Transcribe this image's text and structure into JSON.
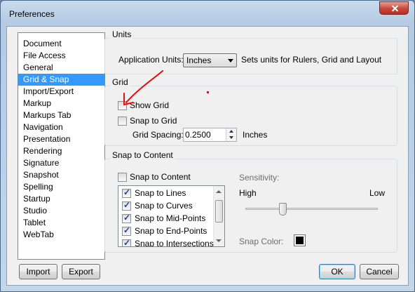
{
  "window": {
    "title": "Preferences"
  },
  "categories": {
    "items": [
      "Document",
      "File Access",
      "General",
      "Grid & Snap",
      "Import/Export",
      "Markup",
      "Markups Tab",
      "Navigation",
      "Presentation",
      "Rendering",
      "Signature",
      "Snapshot",
      "Spelling",
      "Startup",
      "Studio",
      "Tablet",
      "WebTab"
    ],
    "selected": "Grid & Snap"
  },
  "units": {
    "title": "Units",
    "label": "Application Units:",
    "value": "Inches",
    "description": "Sets units for Rulers, Grid and Layout"
  },
  "grid": {
    "title": "Grid",
    "show_grid_label": "Show Grid",
    "show_grid_checked": false,
    "snap_to_grid_label": "Snap to Grid",
    "snap_to_grid_checked": false,
    "spacing_label": "Grid Spacing:",
    "spacing_value": "0.2500",
    "spacing_unit": "Inches"
  },
  "snap": {
    "title": "Snap to Content",
    "snap_to_content_label": "Snap to Content",
    "snap_to_content_checked": false,
    "options": [
      {
        "label": "Snap to Lines",
        "checked": true
      },
      {
        "label": "Snap to Curves",
        "checked": true
      },
      {
        "label": "Snap to Mid-Points",
        "checked": true
      },
      {
        "label": "Snap to End-Points",
        "checked": true
      },
      {
        "label": "Snap to Intersections",
        "checked": true
      }
    ],
    "sensitivity_label": "Sensitivity:",
    "high_label": "High",
    "low_label": "Low",
    "sensitivity_level": 0.27,
    "snap_color_label": "Snap Color:",
    "snap_color": "#000000"
  },
  "buttons": {
    "import": "Import",
    "export": "Export",
    "ok": "OK",
    "cancel": "Cancel"
  },
  "annotation_color": "#e01010"
}
